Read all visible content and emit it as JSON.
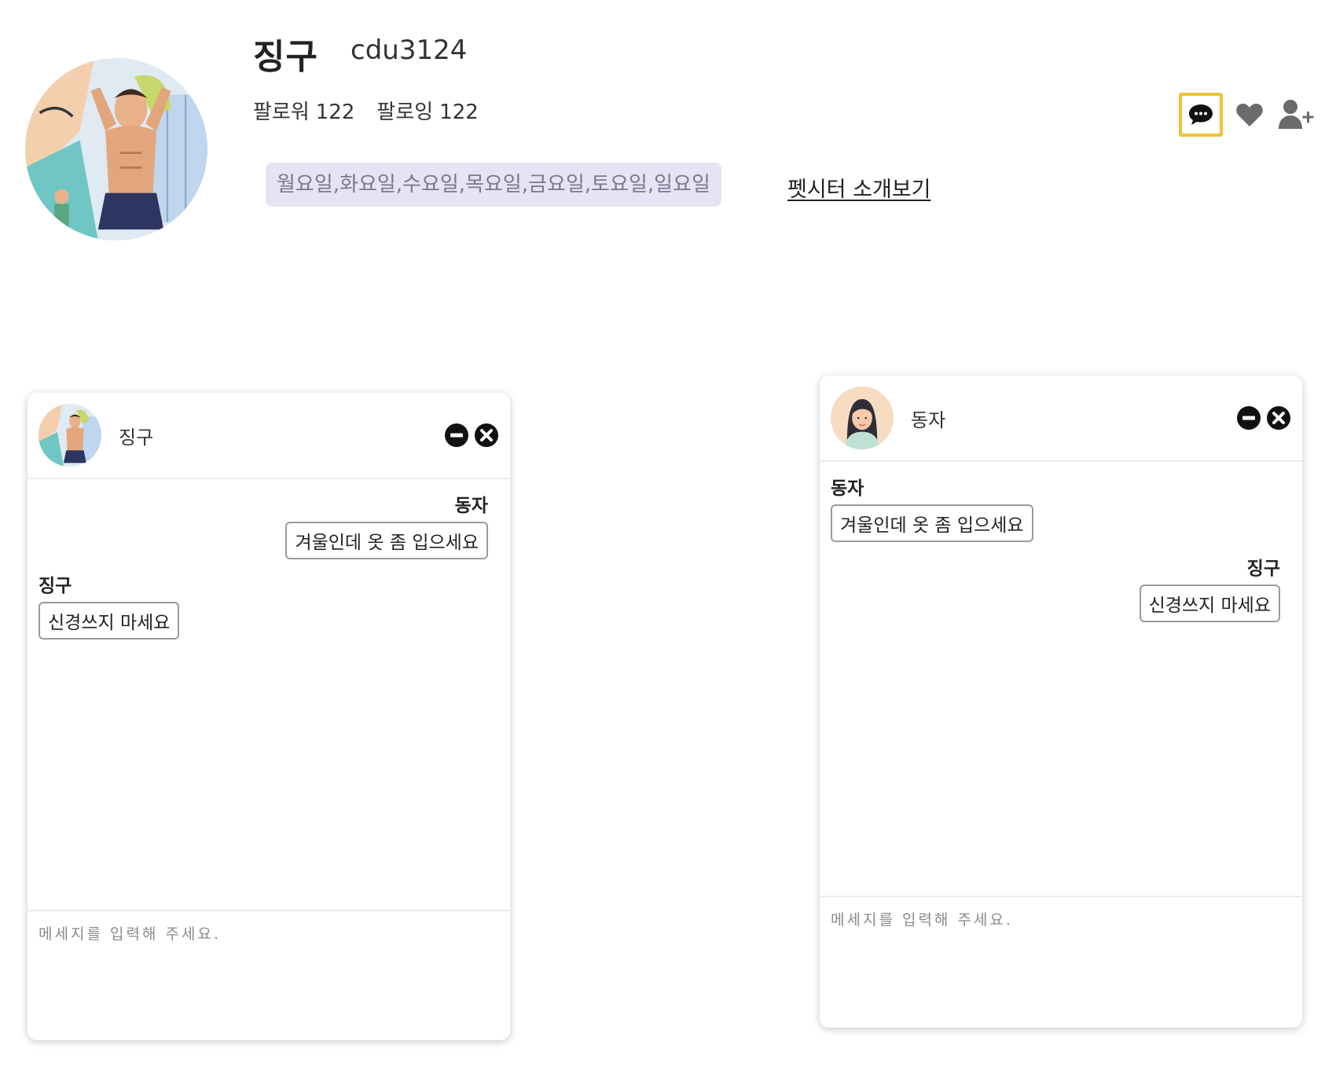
{
  "profile": {
    "name": "징구",
    "handle": "cdu3124",
    "followers_label": "팔로워",
    "followers_count": "122",
    "following_label": "팔로잉",
    "following_count": "122",
    "schedule": "월요일,화요일,수요일,목요일,금요일,토요일,일요일",
    "intro_link": "펫시터 소개보기"
  },
  "actions": [
    {
      "icon": "chat-icon",
      "highlighted": true,
      "highlight_color": "#f1c232"
    },
    {
      "icon": "heart-icon"
    },
    {
      "icon": "add-user-icon"
    }
  ],
  "chat_windows": [
    {
      "title": "징구",
      "avatar": "user-photo",
      "messages": [
        {
          "sender": "동자",
          "text": "겨울인데 옷 좀 입으세요",
          "align": "right"
        },
        {
          "sender": "징구",
          "text": "신경쓰지 마세요",
          "align": "left"
        }
      ],
      "input_placeholder": "메세지를 입력해 주세요."
    },
    {
      "title": "동자",
      "avatar": "woman-illustration",
      "messages": [
        {
          "sender": "동자",
          "text": "겨울인데 옷 좀 입으세요",
          "align": "left"
        },
        {
          "sender": "징구",
          "text": "신경쓰지 마세요",
          "align": "right"
        }
      ],
      "input_placeholder": "메세지를 입력해 주세요."
    }
  ],
  "colors": {
    "schedule_bg": "#e6e3f2",
    "schedule_text": "#7b7893",
    "icon_gray": "#6b6b6b"
  }
}
